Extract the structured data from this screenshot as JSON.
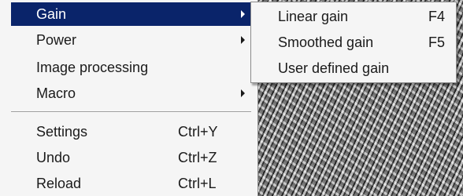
{
  "menu": {
    "items": [
      {
        "label": "Gain",
        "has_submenu": true,
        "selected": true
      },
      {
        "label": "Power",
        "has_submenu": true
      },
      {
        "label": "Image processing"
      },
      {
        "label": "Macro",
        "has_submenu": true
      },
      {
        "label": "Settings",
        "shortcut": "Ctrl+Y"
      },
      {
        "label": "Undo",
        "shortcut": "Ctrl+Z"
      },
      {
        "label": "Reload",
        "shortcut": "Ctrl+L"
      }
    ]
  },
  "submenu": {
    "items": [
      {
        "label": "Linear gain",
        "shortcut": "F4"
      },
      {
        "label": "Smoothed gain",
        "shortcut": "F5"
      },
      {
        "label": "User defined gain"
      }
    ]
  },
  "colors": {
    "selection_bg": "#0a246a",
    "menu_bg": "#f5f5f5"
  }
}
